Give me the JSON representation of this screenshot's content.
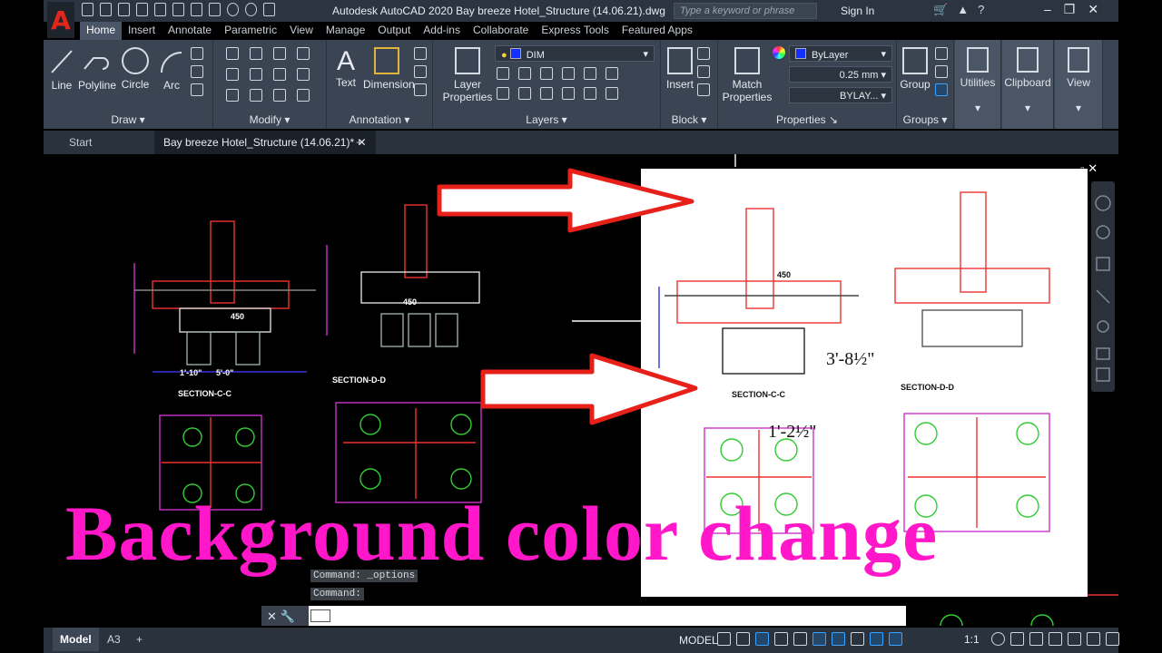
{
  "window": {
    "title": "Autodesk AutoCAD 2020   Bay breeze Hotel_Structure (14.06.21).dwg",
    "search_placeholder": "Type a keyword or phrase",
    "sign_in": "Sign In",
    "logo_letter": "A"
  },
  "ribbon_tabs": [
    "Home",
    "Insert",
    "Annotate",
    "Parametric",
    "View",
    "Manage",
    "Output",
    "Add-ins",
    "Collaborate",
    "Express Tools",
    "Featured Apps"
  ],
  "draw": {
    "title": "Draw",
    "line": "Line",
    "polyline": "Polyline",
    "circle": "Circle",
    "arc": "Arc"
  },
  "modify": {
    "title": "Modify"
  },
  "annotation": {
    "title": "Annotation",
    "text": "Text",
    "dimension": "Dimension"
  },
  "layers": {
    "title": "Layers",
    "layer_properties_1": "Layer",
    "layer_properties_2": "Properties",
    "current_layer": "DIM",
    "layer_color": "#1431ff"
  },
  "block": {
    "title": "Block",
    "insert": "Insert"
  },
  "properties": {
    "title": "Properties",
    "match_1": "Match",
    "match_2": "Properties",
    "color": "ByLayer",
    "lineweight": "0.25 mm",
    "linetype": "BYLAY..."
  },
  "groups": {
    "title": "Groups",
    "group": "Group"
  },
  "utilities": "Utilities",
  "clipboard": "Clipboard",
  "view_label": "View",
  "file_tabs": {
    "start": "Start",
    "active": "Bay breeze Hotel_Structure (14.06.21)*",
    "add": "+"
  },
  "drawing": {
    "headline": "Background color change",
    "accent_color": "#ff17c9",
    "section_cc": "SECTION-C-C",
    "section_dd": "SECTION-D-D",
    "dim_1": "1'-10\"",
    "dim_2": "5'-0\"",
    "dim_3": "450",
    "dim_4": "3'-8½\"",
    "dim_5": "1'-2½\""
  },
  "command": {
    "history_1": "Command:  _options",
    "history_2": "Command:"
  },
  "layouts": [
    "Model",
    "A3"
  ],
  "status": {
    "model": "MODEL",
    "scale": "1:1"
  }
}
